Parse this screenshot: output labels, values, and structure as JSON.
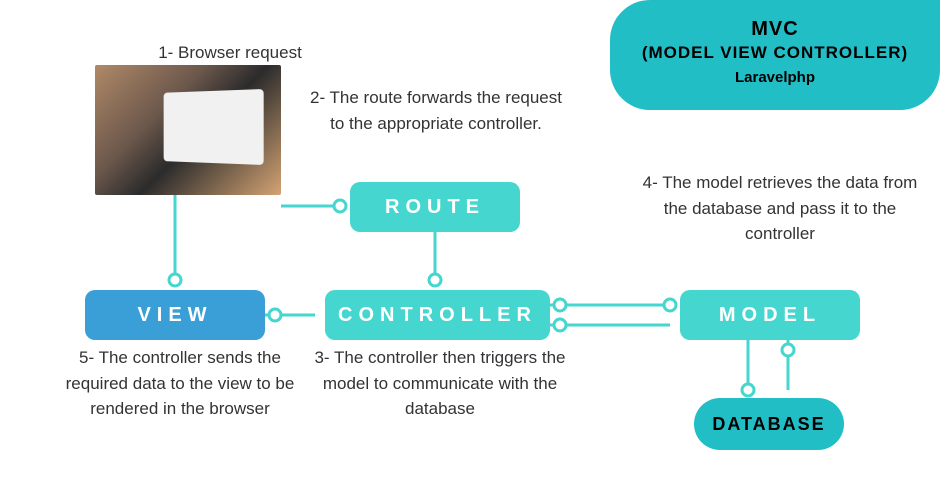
{
  "header": {
    "title": "MVC",
    "subtitle": "(MODEL VIEW CONTROLLER)",
    "tag": "Laravelphp"
  },
  "captions": {
    "c1": "1- Browser request",
    "c2": "2- The route forwards the request to the appropriate controller.",
    "c3": "3- The controller then triggers the model to communicate with the database",
    "c4": "4- The model retrieves the data from the database and pass it to the controller",
    "c5": "5- The controller sends the required data to the view to be rendered in the browser"
  },
  "boxes": {
    "route": "ROUTE",
    "controller": "CONTROLLER",
    "model": "MODEL",
    "view": "VIEW",
    "database": "DATABASE"
  }
}
